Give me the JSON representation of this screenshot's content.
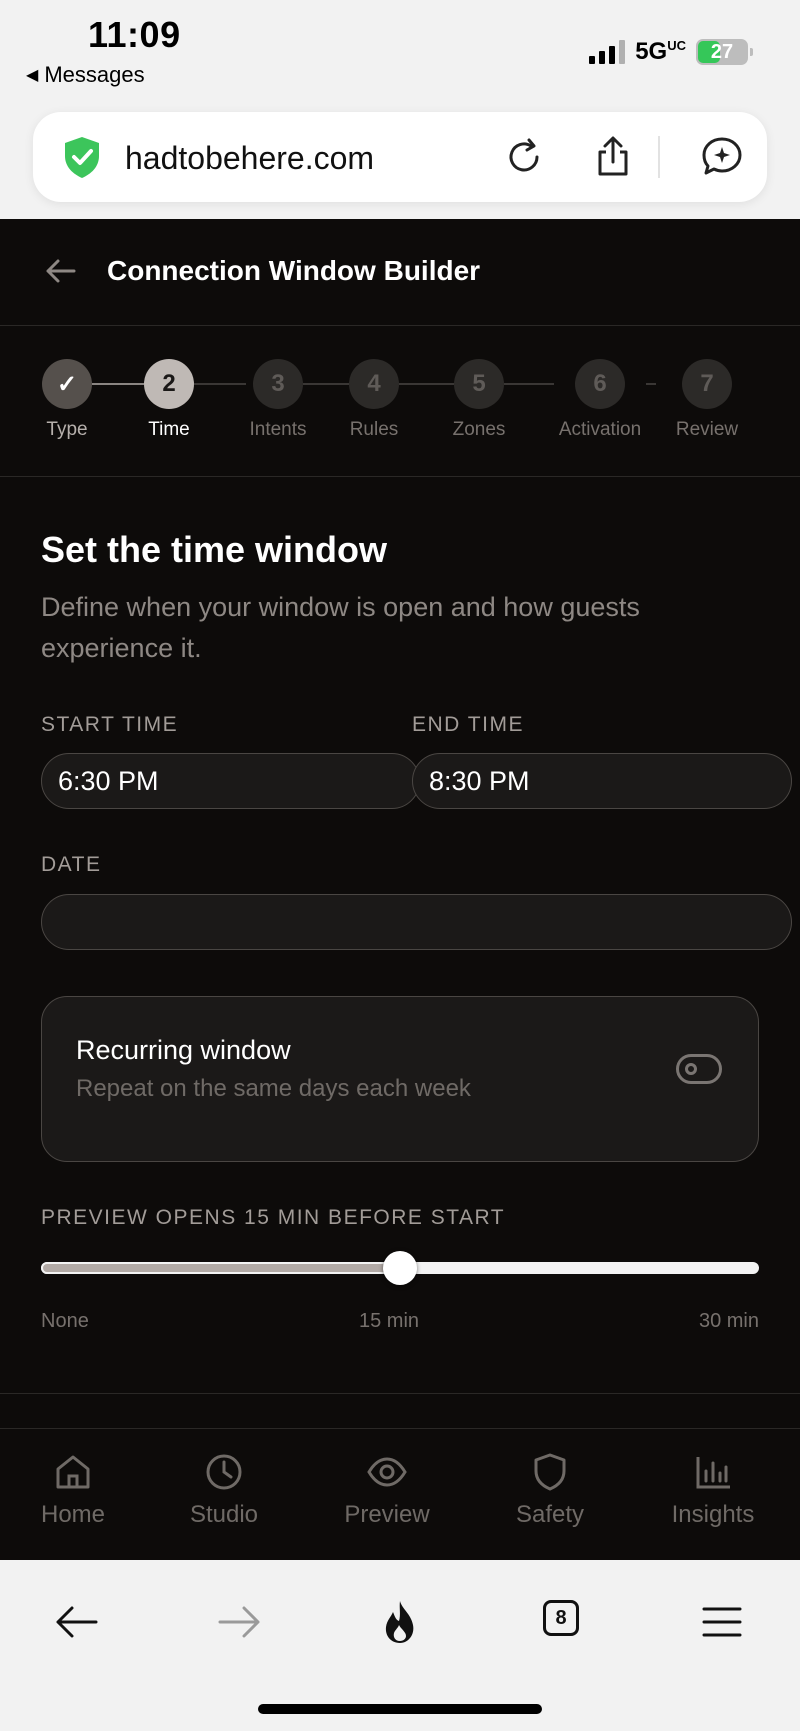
{
  "status_bar": {
    "time": "11:09",
    "back_label": "Messages",
    "network": "5G",
    "network_suffix": "UC",
    "battery": "27"
  },
  "browser": {
    "url": "hadtobehere.com",
    "tab_count": "8"
  },
  "app": {
    "title": "Connection Window Builder",
    "steps": [
      {
        "number": "✓",
        "label": "Type",
        "state": "done"
      },
      {
        "number": "2",
        "label": "Time",
        "state": "active"
      },
      {
        "number": "3",
        "label": "Intents",
        "state": "pending"
      },
      {
        "number": "4",
        "label": "Rules",
        "state": "pending"
      },
      {
        "number": "5",
        "label": "Zones",
        "state": "pending"
      },
      {
        "number": "6",
        "label": "Activation",
        "state": "pending"
      },
      {
        "number": "7",
        "label": "Review",
        "state": "pending"
      }
    ],
    "section_title": "Set the time window",
    "section_desc": "Define when your window is open and how guests experience it.",
    "start_time_label": "START TIME",
    "start_time_value": "6:30 PM",
    "end_time_label": "END TIME",
    "end_time_value": "8:30 PM",
    "date_label": "DATE",
    "date_value": "",
    "recurring_title": "Recurring window",
    "recurring_sub": "Repeat on the same days each week",
    "recurring_on": false,
    "preview_label": "PREVIEW OPENS 15 MIN BEFORE START",
    "preview_fraction": 0.5,
    "slider_ticks": [
      "None",
      "15 min",
      "30 min"
    ],
    "tabs": [
      "Home",
      "Studio",
      "Preview",
      "Safety",
      "Insights"
    ]
  }
}
